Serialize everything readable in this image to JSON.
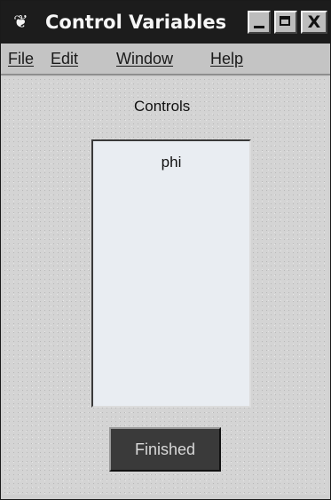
{
  "window": {
    "title": "Control Variables",
    "title_icon": "❦"
  },
  "title_buttons": {
    "close_glyph": "X"
  },
  "menubar": {
    "items": [
      "File",
      "Edit",
      "Window",
      "Help"
    ]
  },
  "main": {
    "controls_label": "Controls",
    "list_items": [
      "phi"
    ],
    "finished_label": "Finished"
  }
}
